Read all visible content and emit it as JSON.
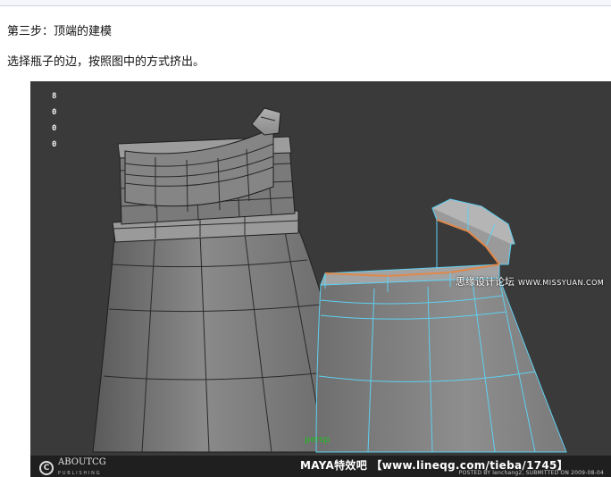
{
  "article": {
    "step_title": "第三步：顶端的建模",
    "instruction": "选择瓶子的边，按照图中的方式挤出。"
  },
  "viewport": {
    "poly_stats": [
      "8",
      "0",
      "0",
      "0"
    ],
    "camera_label": "persp",
    "watermark": "思缘设计论坛",
    "watermark_site": "WWW.MISSYUAN.COM",
    "footer": {
      "logo_name": "ABOUTCG",
      "logo_sub": "PUBLISHING",
      "source_text": "MAYA特效吧 【www.lineqg.com/tieba/1745】",
      "posted_text": "POSTED BY lenchang2, SUBMITTED ON 2009-08-04"
    }
  },
  "colors": {
    "viewport_bg": "#3a3a3a",
    "mesh_fill": "#7d7d7d",
    "wire_selected": "#5fd0f0",
    "edge_selected": "#e0884a"
  }
}
